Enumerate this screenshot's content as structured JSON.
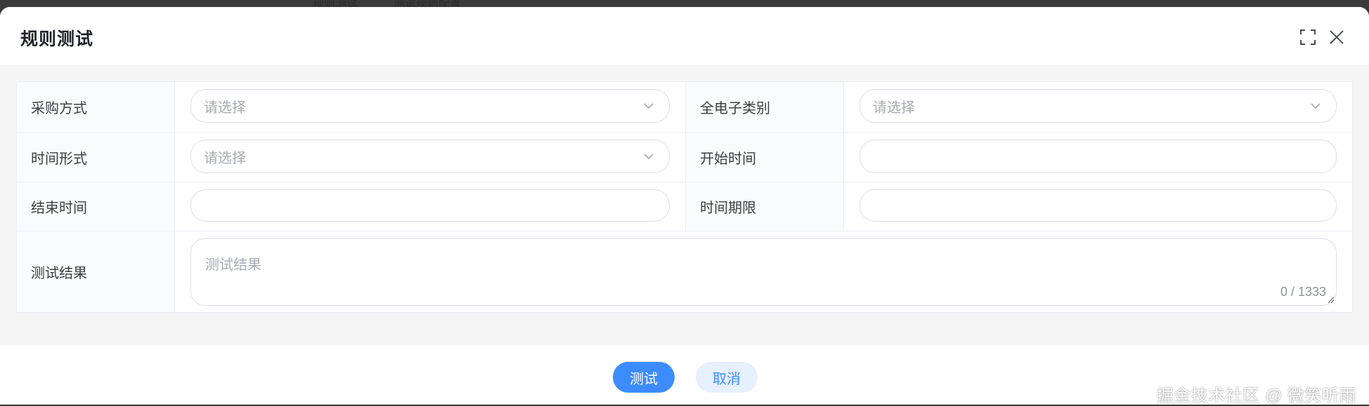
{
  "backdrop": {
    "snippet": "规则测试",
    "snippet2": "测试规则配置"
  },
  "dialog": {
    "title": "规则测试",
    "fullscreen_icon": "fullscreen-icon",
    "close_icon": "close-icon"
  },
  "form": {
    "purchase_method": {
      "label": "采购方式",
      "placeholder": "请选择"
    },
    "electronic_category": {
      "label": "全电子类别",
      "placeholder": "请选择"
    },
    "time_form": {
      "label": "时间形式",
      "placeholder": "请选择"
    },
    "start_time": {
      "label": "开始时间",
      "value": ""
    },
    "end_time": {
      "label": "结束时间",
      "value": ""
    },
    "time_limit": {
      "label": "时间期限",
      "value": ""
    },
    "test_result": {
      "label": "测试结果",
      "placeholder": "测试结果",
      "count": "0 / 1333"
    }
  },
  "footer": {
    "test_label": "测试",
    "cancel_label": "取消"
  },
  "watermark": "掘金技术社区 @ 微笑听雨",
  "colors": {
    "primary": "#3c8cff",
    "cancel_bg": "#e6f0ff",
    "border": "#dcdfe6",
    "label_bg": "#fafbfd"
  }
}
